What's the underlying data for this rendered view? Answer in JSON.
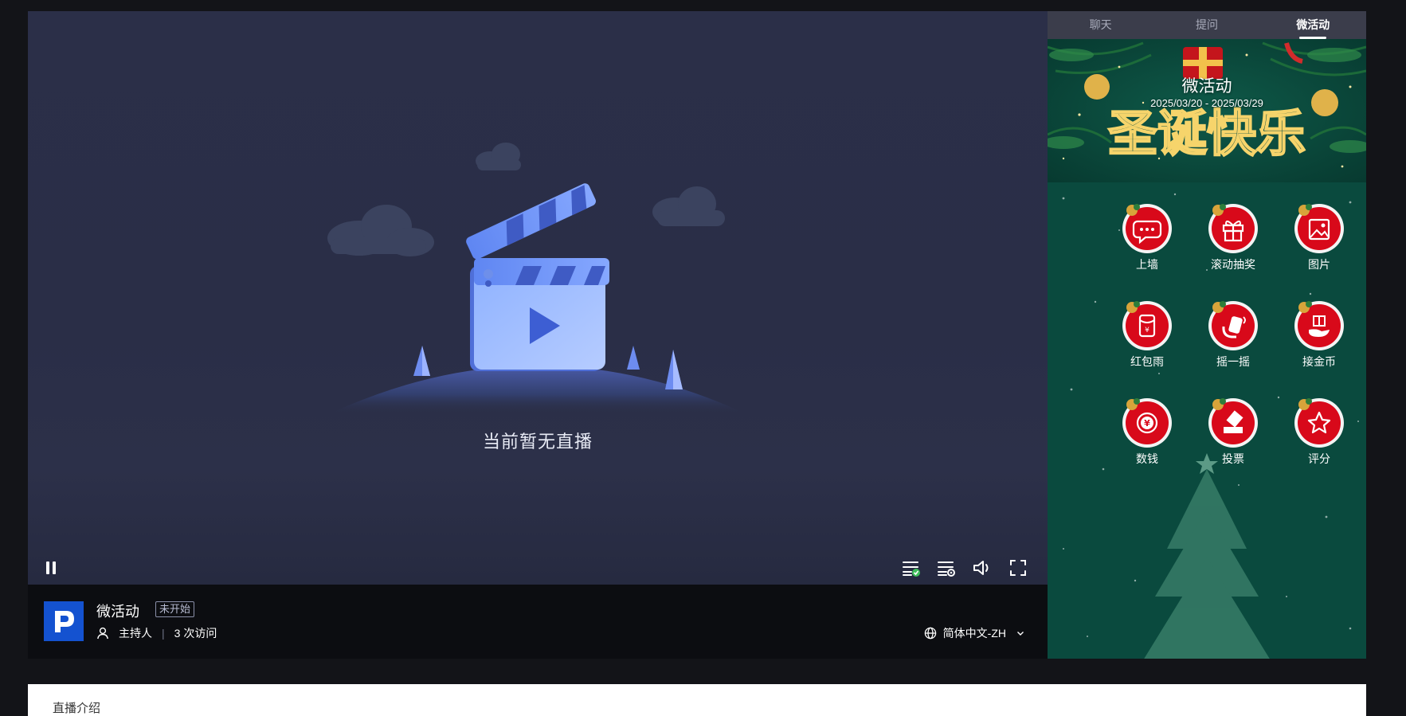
{
  "player": {
    "empty_message": "当前暂无直播",
    "controls": {
      "pause_icon": "pause-icon",
      "subtitle_icon": "subtitle-check-icon",
      "settings_icon": "subtitle-settings-icon",
      "volume_icon": "volume-icon",
      "fullscreen_icon": "fullscreen-icon"
    }
  },
  "info": {
    "logo_letter": "P",
    "title": "微活动",
    "status": "未开始",
    "host_label": "主持人",
    "separator": "|",
    "visits": "3 次访问",
    "language": "简体中文-ZH"
  },
  "sidebar": {
    "tabs": [
      {
        "label": "聊天"
      },
      {
        "label": "提问"
      },
      {
        "label": "微活动",
        "active": true
      }
    ],
    "banner": {
      "title": "微活动",
      "date_range": "2025/03/20 - 2025/03/29",
      "artwork_text": "圣诞快乐"
    },
    "features": [
      {
        "label": "上墙",
        "icon": "chat-bubble-icon"
      },
      {
        "label": "滚动抽奖",
        "icon": "gift-icon"
      },
      {
        "label": "图片",
        "icon": "image-icon"
      },
      {
        "label": "红包雨",
        "icon": "red-envelope-icon"
      },
      {
        "label": "摇一摇",
        "icon": "shake-hand-icon"
      },
      {
        "label": "接金币",
        "icon": "catch-coin-icon"
      },
      {
        "label": "数钱",
        "icon": "yen-coin-icon"
      },
      {
        "label": "投票",
        "icon": "vote-icon"
      },
      {
        "label": "评分",
        "icon": "star-icon"
      }
    ]
  },
  "intro": {
    "title": "直播介绍"
  },
  "colors": {
    "page_bg": "#131418",
    "player_bg": "#2b2f48",
    "info_bar_bg": "#0c0d11",
    "tabs_bg": "#3b3d4b",
    "sidebar_bg": "#0a4a3e",
    "badge_red": "#d8091a",
    "logo_blue": "#1452d0"
  }
}
